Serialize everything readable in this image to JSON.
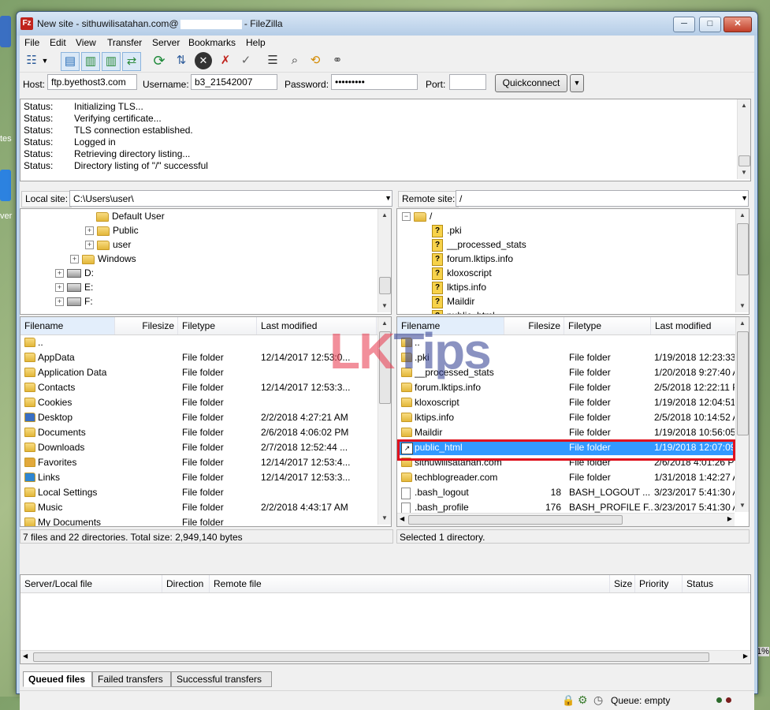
{
  "window": {
    "title_prefix": "New site - sithuwilisatahan.com@",
    "title_suffix": "- FileZilla",
    "app_icon_glyph": "Fz",
    "minimize": "─",
    "maximize": "□",
    "close": "✕"
  },
  "desktop": {
    "label_tes": "tes",
    "label_ver": "ver",
    "label_pct": "1%"
  },
  "menu": [
    "File",
    "Edit",
    "View",
    "Transfer",
    "Server",
    "Bookmarks",
    "Help"
  ],
  "quickconnect": {
    "host_label": "Host:",
    "host_value": "ftp.byethost3.com",
    "user_label": "Username:",
    "user_value": "b3_21542007",
    "pass_label": "Password:",
    "pass_value": "•••••••••",
    "port_label": "Port:",
    "port_value": "",
    "button": "Quickconnect",
    "dropdown": "▼"
  },
  "log": [
    {
      "k": "Status:",
      "v": "Initializing TLS..."
    },
    {
      "k": "Status:",
      "v": "Verifying certificate..."
    },
    {
      "k": "Status:",
      "v": "TLS connection established."
    },
    {
      "k": "Status:",
      "v": "Logged in"
    },
    {
      "k": "Status:",
      "v": "Retrieving directory listing..."
    },
    {
      "k": "Status:",
      "v": "Directory listing of \"/\" successful"
    }
  ],
  "local": {
    "site_label": "Local site:",
    "path": "C:\\Users\\user\\",
    "tree": [
      "Default User",
      "Public",
      "user",
      "Windows",
      "D:",
      "E:",
      "F:"
    ],
    "headers": [
      "Filename",
      "Filesize",
      "Filetype",
      "Last modified"
    ],
    "files": [
      {
        "name": "..",
        "size": "",
        "type": "",
        "date": ""
      },
      {
        "name": "AppData",
        "size": "",
        "type": "File folder",
        "date": "12/14/2017 12:53:0..."
      },
      {
        "name": "Application Data",
        "size": "",
        "type": "File folder",
        "date": ""
      },
      {
        "name": "Contacts",
        "size": "",
        "type": "File folder",
        "date": "12/14/2017 12:53:3..."
      },
      {
        "name": "Cookies",
        "size": "",
        "type": "File folder",
        "date": ""
      },
      {
        "name": "Desktop",
        "size": "",
        "type": "File folder",
        "date": "2/2/2018 4:27:21 AM"
      },
      {
        "name": "Documents",
        "size": "",
        "type": "File folder",
        "date": "2/6/2018 4:06:02 PM"
      },
      {
        "name": "Downloads",
        "size": "",
        "type": "File folder",
        "date": "2/7/2018 12:52:44 ..."
      },
      {
        "name": "Favorites",
        "size": "",
        "type": "File folder",
        "date": "12/14/2017 12:53:4..."
      },
      {
        "name": "Links",
        "size": "",
        "type": "File folder",
        "date": "12/14/2017 12:53:3..."
      },
      {
        "name": "Local Settings",
        "size": "",
        "type": "File folder",
        "date": ""
      },
      {
        "name": "Music",
        "size": "",
        "type": "File folder",
        "date": "2/2/2018 4:43:17 AM"
      },
      {
        "name": "My Documents",
        "size": "",
        "type": "File folder",
        "date": ""
      }
    ],
    "status": "7 files and 22 directories. Total size: 2,949,140 bytes"
  },
  "remote": {
    "site_label": "Remote site:",
    "path": "/",
    "tree": [
      "/",
      ".pki",
      "__processed_stats",
      "forum.lktips.info",
      "kloxoscript",
      "lktips.info",
      "Maildir",
      "public_html"
    ],
    "headers": [
      "Filename",
      "Filesize",
      "Filetype",
      "Last modified"
    ],
    "files": [
      {
        "name": "..",
        "size": "",
        "type": "",
        "date": ""
      },
      {
        "name": ".pki",
        "size": "",
        "type": "File folder",
        "date": "1/19/2018 12:23:33 ..."
      },
      {
        "name": "__processed_stats",
        "size": "",
        "type": "File folder",
        "date": "1/20/2018 9:27:40 A"
      },
      {
        "name": "forum.lktips.info",
        "size": "",
        "type": "File folder",
        "date": "2/5/2018 12:22:11 P"
      },
      {
        "name": "kloxoscript",
        "size": "",
        "type": "File folder",
        "date": "1/19/2018 12:04:51 ..."
      },
      {
        "name": "lktips.info",
        "size": "",
        "type": "File folder",
        "date": "2/5/2018 10:14:52 A"
      },
      {
        "name": "Maildir",
        "size": "",
        "type": "File folder",
        "date": "1/19/2018 10:56:05"
      },
      {
        "name": "public_html",
        "size": "",
        "type": "File folder",
        "date": "1/19/2018 12:07:09"
      },
      {
        "name": "sithuwilisatahan.com",
        "size": "",
        "type": "File folder",
        "date": "2/6/2018 4:01:26 P"
      },
      {
        "name": "techblogreader.com",
        "size": "",
        "type": "File folder",
        "date": "1/31/2018 1:42:27 A"
      },
      {
        "name": ".bash_logout",
        "size": "18",
        "type": "BASH_LOGOUT ...",
        "date": "3/23/2017 5:41:30 A"
      },
      {
        "name": ".bash_profile",
        "size": "176",
        "type": "BASH_PROFILE F...",
        "date": "3/23/2017 5:41:30 A"
      }
    ],
    "selected_index": 7,
    "status": "Selected 1 directory."
  },
  "queue": {
    "headers": [
      "Server/Local file",
      "Direction",
      "Remote file",
      "Size",
      "Priority",
      "Status"
    ],
    "tabs": [
      "Queued files",
      "Failed transfers",
      "Successful transfers"
    ],
    "status": "Queue: empty"
  },
  "watermark": {
    "part1": "LK",
    "part2": "Tips",
    "color1": "#e8354a",
    "color2": "#2b3a8f"
  },
  "colors": {
    "selection": "#3399ff",
    "highlight_box": "#e0121e"
  }
}
